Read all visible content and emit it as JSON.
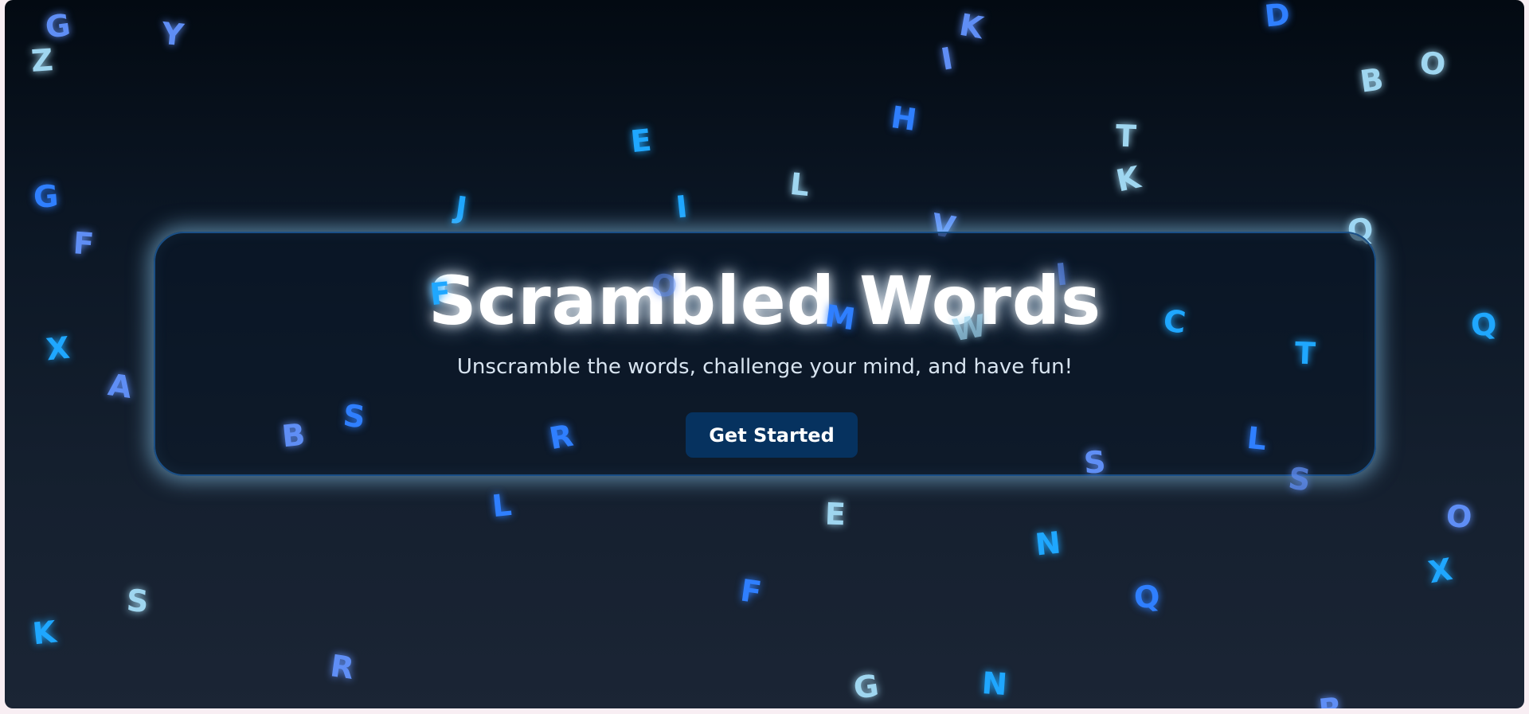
{
  "hero": {
    "title": "Scrambled Words",
    "subtitle": "Unscramble the words, challenge your mind, and have fun!",
    "cta_label": "Get Started"
  },
  "colors": {
    "background_top": "#030a12",
    "background_bottom": "#1b2535",
    "card_border": "#1a4f86",
    "card_glow": "#96d7ff",
    "button_bg": "#06325f",
    "title_text": "#ffffff",
    "subtitle_text": "#d8e4f0",
    "letter_blue": "#2f7fff",
    "letter_cyan": "#1fa7ff",
    "letter_pale": "#9fd6f0",
    "letter_periwinkle": "#5f8ef5"
  },
  "floating_letters": [
    "G",
    "Y",
    "Z",
    "K",
    "I",
    "D",
    "B",
    "O",
    "E",
    "H",
    "T",
    "K",
    "L",
    "G",
    "J",
    "I",
    "V",
    "Q",
    "F",
    "F",
    "O",
    "I",
    "M",
    "W",
    "C",
    "Q",
    "T",
    "X",
    "A",
    "B",
    "S",
    "R",
    "L",
    "S",
    "S",
    "L",
    "E",
    "N",
    "O",
    "X",
    "F",
    "Q",
    "S",
    "K",
    "R",
    "G",
    "N",
    "R"
  ]
}
